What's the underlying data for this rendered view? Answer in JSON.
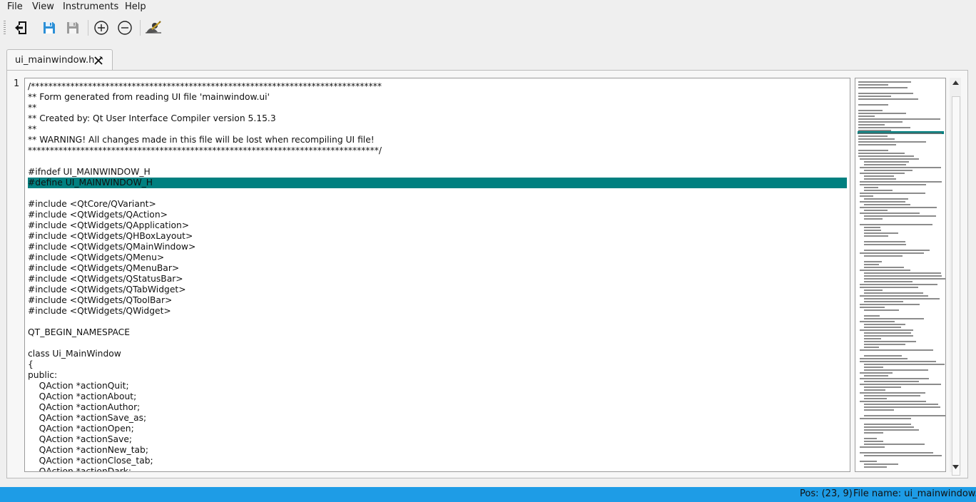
{
  "menubar": {
    "items": [
      "File",
      "View",
      "Instruments",
      "Help"
    ]
  },
  "toolbar": {
    "buttons": [
      "exit-icon",
      "save-icon",
      "save-as-icon",
      "zoom-in-icon",
      "zoom-out-icon",
      "theme-icon"
    ]
  },
  "tabs": [
    {
      "label": "ui_mainwindow.h"
    }
  ],
  "editor": {
    "line_number": "1",
    "highlight_color": "#008080",
    "lines": [
      "/********************************************************************************",
      "** Form generated from reading UI file 'mainwindow.ui'",
      "**",
      "** Created by: Qt User Interface Compiler version 5.15.3",
      "**",
      "** WARNING! All changes made in this file will be lost when recompiling UI file!",
      "********************************************************************************/",
      "",
      "#ifndef UI_MAINWINDOW_H",
      "#define UI_MAINWINDOW_H",
      "",
      "#include <QtCore/QVariant>",
      "#include <QtWidgets/QAction>",
      "#include <QtWidgets/QApplication>",
      "#include <QtWidgets/QHBoxLayout>",
      "#include <QtWidgets/QMainWindow>",
      "#include <QtWidgets/QMenu>",
      "#include <QtWidgets/QMenuBar>",
      "#include <QtWidgets/QStatusBar>",
      "#include <QtWidgets/QTabWidget>",
      "#include <QtWidgets/QToolBar>",
      "#include <QtWidgets/QWidget>",
      "",
      "QT_BEGIN_NAMESPACE",
      "",
      "class Ui_MainWindow",
      "{",
      "public:",
      "    QAction *actionQuit;",
      "    QAction *actionAbout;",
      "    QAction *actionAuthor;",
      "    QAction *actionSave_as;",
      "    QAction *actionOpen;",
      "    QAction *actionSave;",
      "    QAction *actionNew_tab;",
      "    QAction *actionClose_tab;",
      "    QAction *actionDark;"
    ]
  },
  "statusbar": {
    "position": "Pos: (23, 9)",
    "filename": "File name: ui_mainwindow.h",
    "color": "#1e9ce6"
  }
}
